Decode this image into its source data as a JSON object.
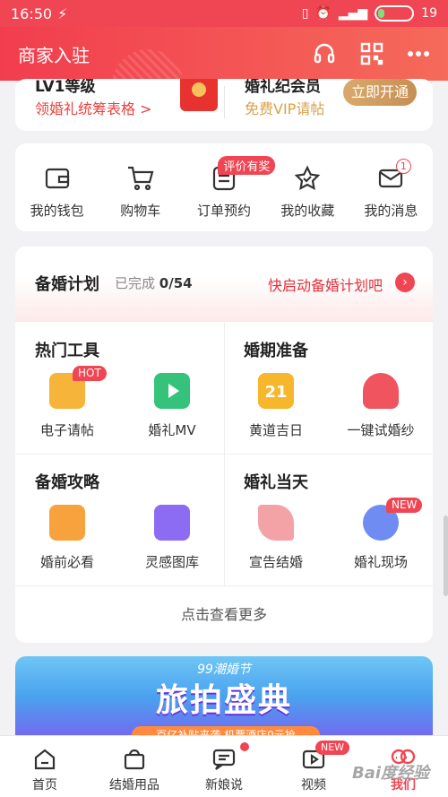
{
  "status": {
    "time": "16:50",
    "battery": "19",
    "battery_level": 0.19
  },
  "header": {
    "title": "商家入驻",
    "icons": [
      "headset-icon",
      "qr-code-icon",
      "more-icon"
    ]
  },
  "vip": {
    "level_title": "LV1等级",
    "level_sub": "领婚礼统筹表格 >",
    "member_title": "婚礼纪会员",
    "member_sub": "免费VIP请帖",
    "button": "立即开通"
  },
  "quick": {
    "items": [
      {
        "label": "我的钱包",
        "icon": "wallet-icon"
      },
      {
        "label": "购物车",
        "icon": "cart-icon"
      },
      {
        "label": "订单预约",
        "icon": "order-icon",
        "badge": "评价有奖"
      },
      {
        "label": "我的收藏",
        "icon": "star-icon"
      },
      {
        "label": "我的消息",
        "icon": "message-icon",
        "count": "1"
      }
    ]
  },
  "plan": {
    "title": "备婚计划",
    "progress_label": "已完成",
    "progress_value": "0/54",
    "link": "快启动备婚计划吧",
    "arrow": "›"
  },
  "tools": {
    "hot": {
      "title": "热门工具",
      "items": [
        {
          "label": "电子请帖",
          "badge": "HOT"
        },
        {
          "label": "婚礼MV"
        }
      ]
    },
    "prep": {
      "title": "婚期准备",
      "items": [
        {
          "label": "黄道吉日",
          "date": "21"
        },
        {
          "label": "一键试婚纱"
        }
      ]
    },
    "guide": {
      "title": "备婚攻略",
      "items": [
        {
          "label": "婚前必看"
        },
        {
          "label": "灵感图库"
        }
      ]
    },
    "day": {
      "title": "婚礼当天",
      "items": [
        {
          "label": "宣告结婚"
        },
        {
          "label": "婚礼现场",
          "badge": "NEW"
        }
      ]
    },
    "more": "点击查看更多"
  },
  "banner": {
    "subtitle": "99潮婚节",
    "title": "旅拍盛典",
    "strip": "百亿补贴来袭 机票酒店0元抢"
  },
  "nav": {
    "items": [
      {
        "label": "首页",
        "icon": "home-icon"
      },
      {
        "label": "结婚用品",
        "icon": "bag-icon"
      },
      {
        "label": "新娘说",
        "icon": "chat-icon"
      },
      {
        "label": "视频",
        "icon": "video-icon",
        "badge": "NEW"
      },
      {
        "label": "我们",
        "icon": "couple-icon",
        "active": true
      }
    ]
  },
  "watermark": "Bai度经验",
  "colors": {
    "brand": "#f04552",
    "gold": "#c68f53"
  }
}
